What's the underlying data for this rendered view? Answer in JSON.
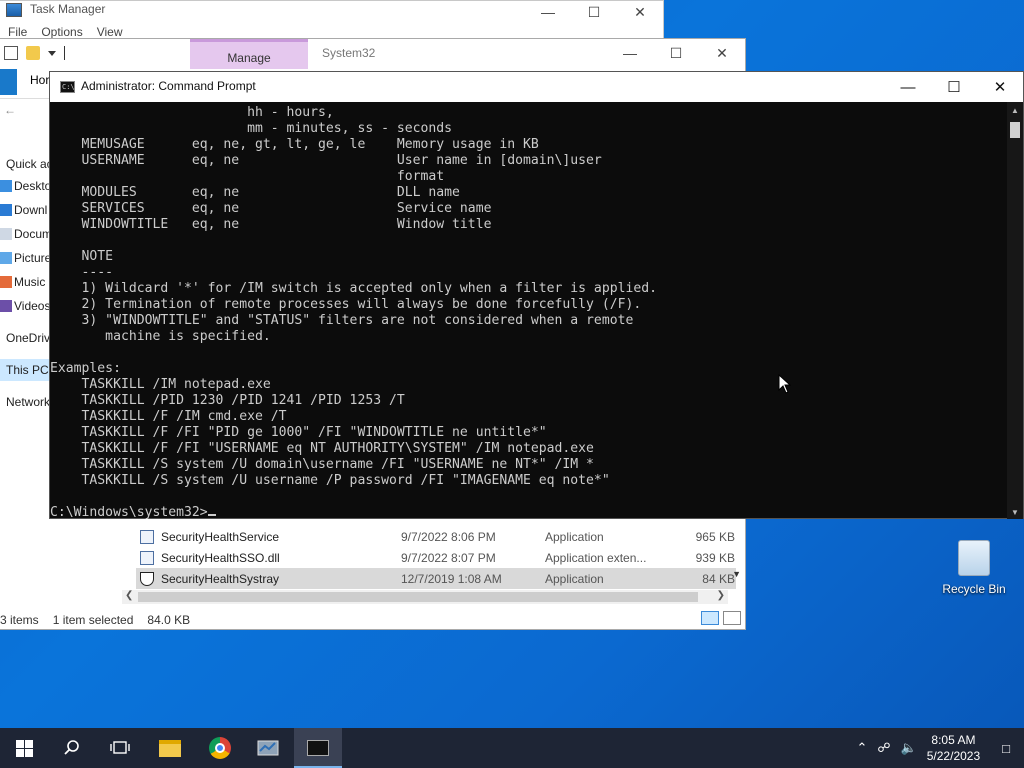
{
  "task_manager": {
    "title": "Task Manager",
    "menu": [
      "File",
      "Options",
      "View"
    ]
  },
  "explorer": {
    "tab_manage": "Manage",
    "path_title": "System32",
    "ribbon_home": "Hor",
    "nav": [
      "Quick ac",
      "Deskto",
      "Downl",
      "Docum",
      "Picture",
      "Music",
      "Videos",
      "OneDriv",
      "This PC",
      "Network"
    ],
    "files": [
      {
        "name": "SecurityHealthService",
        "date": "9/7/2022 8:06 PM",
        "type": "Application",
        "size": "965 KB"
      },
      {
        "name": "SecurityHealthSSO.dll",
        "date": "9/7/2022 8:07 PM",
        "type": "Application exten...",
        "size": "939 KB"
      },
      {
        "name": "SecurityHealthSystray",
        "date": "12/7/2019 1:08 AM",
        "type": "Application",
        "size": "84 KB"
      }
    ],
    "status": {
      "items": "3 items",
      "selected": "1 item selected",
      "size": "84.0 KB"
    }
  },
  "cmd": {
    "title": "Administrator: Command Prompt",
    "icon_text": "C:\\",
    "output": "                         hh - hours,\n                         mm - minutes, ss - seconds\n    MEMUSAGE      eq, ne, gt, lt, ge, le    Memory usage in KB\n    USERNAME      eq, ne                    User name in [domain\\]user\n                                            format\n    MODULES       eq, ne                    DLL name\n    SERVICES      eq, ne                    Service name\n    WINDOWTITLE   eq, ne                    Window title\n\n    NOTE\n    ----\n    1) Wildcard '*' for /IM switch is accepted only when a filter is applied.\n    2) Termination of remote processes will always be done forcefully (/F).\n    3) \"WINDOWTITLE\" and \"STATUS\" filters are not considered when a remote\n       machine is specified.\n\nExamples:\n    TASKKILL /IM notepad.exe\n    TASKKILL /PID 1230 /PID 1241 /PID 1253 /T\n    TASKKILL /F /IM cmd.exe /T\n    TASKKILL /F /FI \"PID ge 1000\" /FI \"WINDOWTITLE ne untitle*\"\n    TASKKILL /F /FI \"USERNAME eq NT AUTHORITY\\SYSTEM\" /IM notepad.exe\n    TASKKILL /S system /U domain\\username /FI \"USERNAME ne NT*\" /IM *\n    TASKKILL /S system /U username /P password /FI \"IMAGENAME eq note*\"\n\n",
    "prompt": "C:\\Windows\\system32>"
  },
  "desktop": {
    "recycle_bin": "Recycle Bin"
  },
  "taskbar": {
    "time": "8:05 AM",
    "date": "5/22/2023"
  }
}
